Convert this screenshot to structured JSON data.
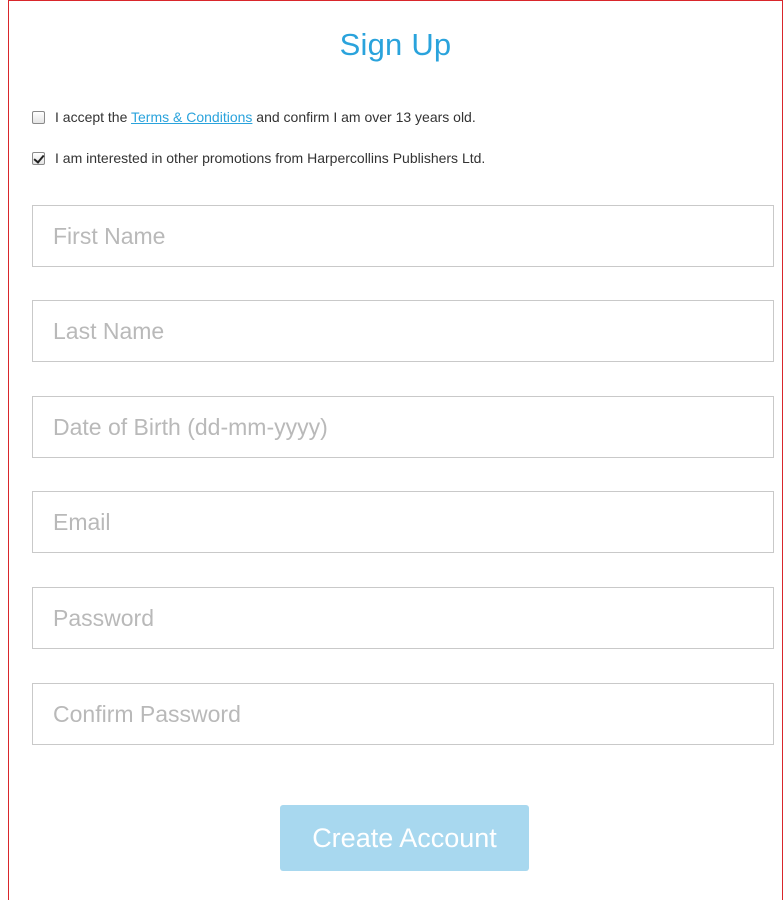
{
  "form": {
    "title": "Sign Up",
    "terms": {
      "checked": false,
      "prefix": "I accept the ",
      "link_text": "Terms & Conditions",
      "suffix": " and confirm I am over 13 years old."
    },
    "promotions": {
      "checked": true,
      "label": "I am interested in other promotions from Harpercollins Publishers Ltd."
    },
    "fields": {
      "first_name": {
        "placeholder": "First Name",
        "value": ""
      },
      "last_name": {
        "placeholder": "Last Name",
        "value": ""
      },
      "dob": {
        "placeholder": "Date of Birth (dd-mm-yyyy)",
        "value": ""
      },
      "email": {
        "placeholder": "Email",
        "value": ""
      },
      "password": {
        "placeholder": "Password",
        "value": ""
      },
      "confirm_password": {
        "placeholder": "Confirm Password",
        "value": ""
      }
    },
    "submit_label": "Create Account"
  },
  "colors": {
    "accent": "#2aa3dc",
    "button_disabled": "#a8d8ef",
    "frame_border": "#d9262b",
    "input_border": "#c9c9c9",
    "placeholder": "#b9b9b9"
  }
}
